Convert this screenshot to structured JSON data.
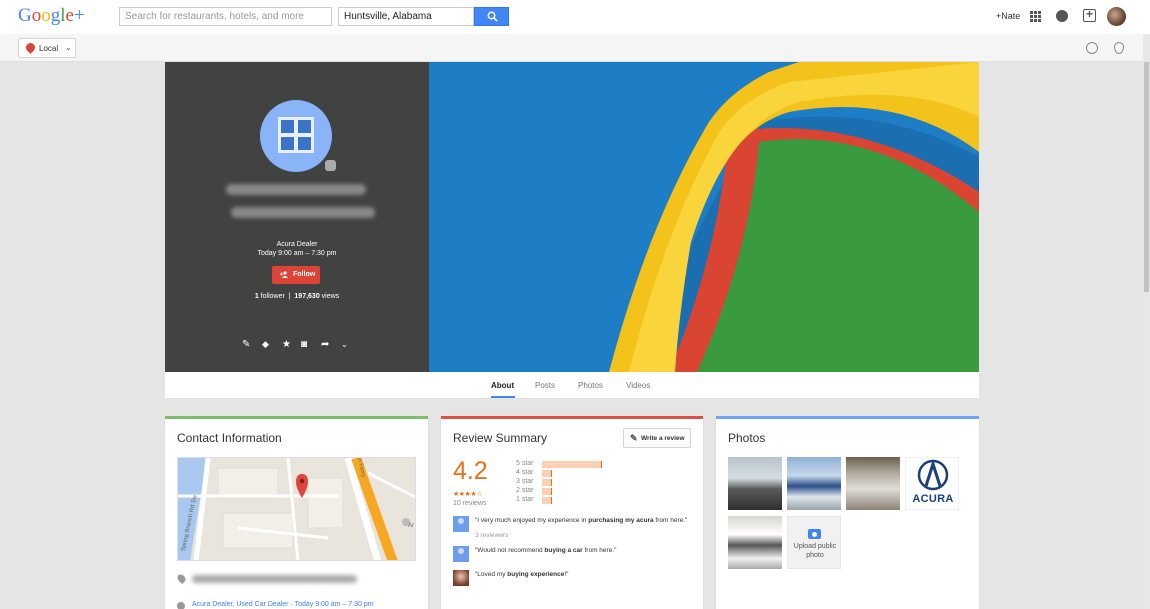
{
  "topbar": {
    "logo_parts": [
      "G",
      "o",
      "o",
      "g",
      "l",
      "e",
      "+"
    ],
    "search_placeholder": "Search for restaurants, hotels, and more",
    "location_value": "Huntsville, Alabama",
    "user_label": "+Nate"
  },
  "subbar": {
    "local_label": "Local"
  },
  "profile": {
    "category": "Acura Dealer",
    "hours": "Today 9:00 am – 7:30 pm",
    "follow_label": "Follow",
    "followers_count": "1",
    "followers_label": "follower",
    "views_count": "197,630",
    "views_label": "views"
  },
  "tabs": [
    {
      "label": "About",
      "active": true
    },
    {
      "label": "Posts",
      "active": false
    },
    {
      "label": "Photos",
      "active": false
    },
    {
      "label": "Videos",
      "active": false
    }
  ],
  "contact": {
    "title": "Contact Information",
    "map_streets": [
      "Spring Branch Rd Sw",
      "Leeman Ferry",
      "Ar"
    ],
    "category_hours": "Acura Dealer, Used Car Dealer · Today 9:00 am – 7:30 pm",
    "accent_color": "#7bbf6a"
  },
  "review": {
    "title": "Review Summary",
    "write_label": "Write a review",
    "rating": "4.2",
    "stars": "★★★★☆",
    "count_text": "10 reviews",
    "histogram": [
      {
        "label": "5 star",
        "value": 6
      },
      {
        "label": "4 star",
        "value": 1
      },
      {
        "label": "3 star",
        "value": 1
      },
      {
        "label": "2 star",
        "value": 1
      },
      {
        "label": "1 star",
        "value": 1
      }
    ],
    "snippets": [
      {
        "pre": "\"I very much enjoyed my experience in ",
        "bold": "purchasing my acura",
        "post": " from here.\"",
        "sub": "3 reviewers"
      },
      {
        "pre": "\"Would not recommend ",
        "bold": "buying a car",
        "post": " from here.\"",
        "sub": ""
      },
      {
        "pre": "\"Loved my ",
        "bold": "buying experience",
        "post": "!\"",
        "sub": ""
      }
    ],
    "accent_color": "#dd5144"
  },
  "photos": {
    "title": "Photos",
    "logo_text": "ACURA",
    "upload_label": "Upload public photo",
    "accent_color": "#6fa5f2"
  }
}
